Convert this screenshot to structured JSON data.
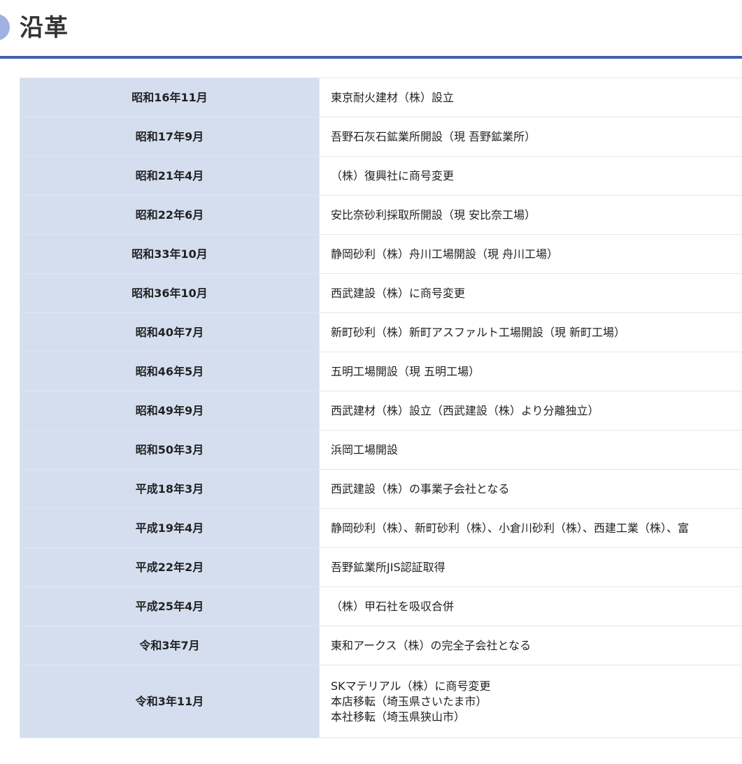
{
  "header": {
    "title": "沿革"
  },
  "history": [
    {
      "date": "昭和16年11月",
      "lines": [
        "東京耐火建材（株）設立"
      ]
    },
    {
      "date": "昭和17年9月",
      "lines": [
        "吾野石灰石鉱業所開設（現 吾野鉱業所）"
      ]
    },
    {
      "date": "昭和21年4月",
      "lines": [
        "（株）復興社に商号変更"
      ]
    },
    {
      "date": "昭和22年6月",
      "lines": [
        "安比奈砂利採取所開設（現 安比奈工場）"
      ]
    },
    {
      "date": "昭和33年10月",
      "lines": [
        "静岡砂利（株）舟川工場開設（現 舟川工場）"
      ]
    },
    {
      "date": "昭和36年10月",
      "lines": [
        "西武建設（株）に商号変更"
      ]
    },
    {
      "date": "昭和40年7月",
      "lines": [
        "新町砂利（株）新町アスファルト工場開設（現 新町工場）"
      ]
    },
    {
      "date": "昭和46年5月",
      "lines": [
        "五明工場開設（現 五明工場）"
      ]
    },
    {
      "date": "昭和49年9月",
      "lines": [
        "西武建材（株）設立（西武建設（株）より分離独立）"
      ]
    },
    {
      "date": "昭和50年3月",
      "lines": [
        "浜岡工場開設"
      ]
    },
    {
      "date": "平成18年3月",
      "lines": [
        "西武建設（株）の事業子会社となる"
      ]
    },
    {
      "date": "平成19年4月",
      "lines": [
        "静岡砂利（株）、新町砂利（株）、小倉川砂利（株）、西建工業（株）、富"
      ]
    },
    {
      "date": "平成22年2月",
      "lines": [
        "吾野鉱業所JIS認証取得"
      ]
    },
    {
      "date": "平成25年4月",
      "lines": [
        "（株）甲石社を吸収合併"
      ]
    },
    {
      "date": "令和3年7月",
      "lines": [
        "東和アークス（株）の完全子会社となる"
      ]
    },
    {
      "date": "令和3年11月",
      "lines": [
        "SKマテリアル（株）に商号変更",
        "本店移転（埼玉県さいたま市）",
        "本社移転（埼玉県狭山市）"
      ]
    }
  ]
}
